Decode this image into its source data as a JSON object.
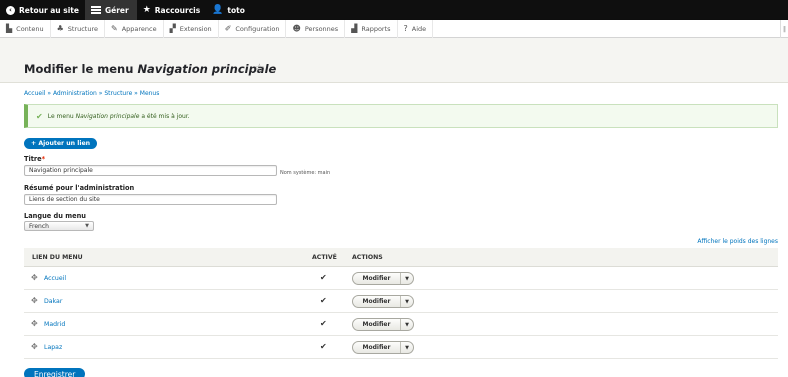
{
  "toolbar": {
    "back_label": "Retour au site",
    "manage_label": "Gérer",
    "shortcuts_label": "Raccourcis",
    "user_label": "toto"
  },
  "menu": [
    {
      "label": "Contenu",
      "icon": "page-icon"
    },
    {
      "label": "Structure",
      "icon": "structure-icon"
    },
    {
      "label": "Apparence",
      "icon": "brush-icon"
    },
    {
      "label": "Extension",
      "icon": "puzzle-icon"
    },
    {
      "label": "Configuration",
      "icon": "wrench-icon"
    },
    {
      "label": "Personnes",
      "icon": "people-icon"
    },
    {
      "label": "Rapports",
      "icon": "bar-chart-icon"
    },
    {
      "label": "Aide",
      "icon": "help-icon"
    }
  ],
  "page": {
    "title_prefix": "Modifier le menu ",
    "title_name": "Navigation principale"
  },
  "breadcrumb": [
    "Accueil",
    "Administration",
    "Structure",
    "Menus"
  ],
  "breadcrumb_sep": " » ",
  "status": {
    "prefix": "Le menu ",
    "name": "Navigation principale",
    "suffix": " a été mis à jour."
  },
  "add_link_label": "+ Ajouter un lien",
  "form": {
    "title_label": "Titre",
    "title_required": "*",
    "title_value": "Navigation principale",
    "system_name": "Nom système: main",
    "summary_label": "Résumé pour l'administration",
    "summary_value": "Liens de section du site",
    "language_label": "Langue du menu",
    "language_value": "French"
  },
  "show_weights_label": "Afficher le poids des lignes",
  "table": {
    "headers": [
      "LIEN DU MENU",
      "ACTIVÉ",
      "ACTIONS"
    ],
    "rows": [
      {
        "link": "Accueil",
        "enabled": "✔",
        "action": "Modifier"
      },
      {
        "link": "Dakar",
        "enabled": "✔",
        "action": "Modifier"
      },
      {
        "link": "Madrid",
        "enabled": "✔",
        "action": "Modifier"
      },
      {
        "link": "Lapaz",
        "enabled": "✔",
        "action": "Modifier"
      }
    ]
  },
  "save_label": "Enregistrer",
  "colors": {
    "accent": "#0074bd",
    "toolbar": "#0f0f0f",
    "status_green": "#77b259"
  }
}
